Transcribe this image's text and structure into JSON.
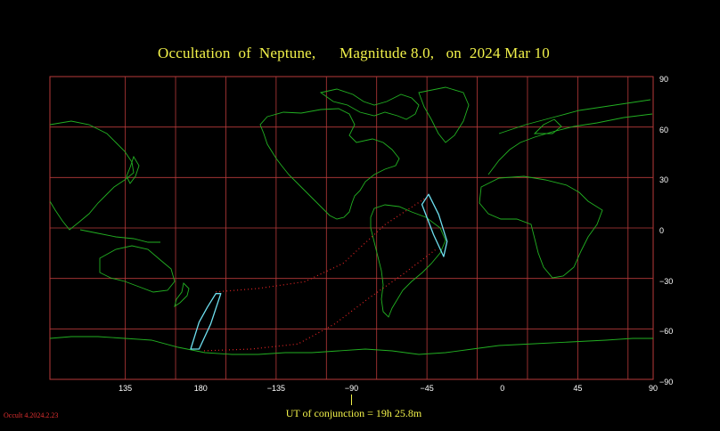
{
  "title": "Occultation  of  Neptune,      Magnitude 8.0,   on  2024 Mar 10",
  "conjunction_label": "UT of conjunction = 19h 25.8m",
  "footer": "Occult 4.2024.2.23",
  "colors": {
    "background": "#000000",
    "grid": "#b83a3a",
    "coast": "#22b022",
    "path": "#6ee0f0",
    "dots": "#e02424",
    "title": "#f2f24a"
  },
  "lon_labels": [
    "135",
    "180",
    "−135",
    "−90",
    "−45",
    "0",
    "45",
    "90"
  ],
  "lat_labels": [
    "90",
    "60",
    "30",
    "0",
    "−30",
    "−60",
    "−90"
  ],
  "map": {
    "projection": "equirectangular",
    "lon_range": [
      90,
      450
    ],
    "lat_range": [
      -90,
      90
    ],
    "graticule_step_deg": 30,
    "visibility_region_1": {
      "description": "closed occultation visibility curve",
      "points": [
        [
          -48,
          14
        ],
        [
          -44,
          20
        ],
        [
          -38,
          8
        ],
        [
          -33,
          -8
        ],
        [
          -35,
          -17
        ],
        [
          -41,
          -4
        ],
        [
          -48,
          14
        ]
      ]
    },
    "visibility_region_2": {
      "points": [
        [
          -176,
          -47
        ],
        [
          -171,
          -39
        ],
        [
          -168,
          -39
        ],
        [
          -174,
          -57
        ],
        [
          -181,
          -72
        ],
        [
          -186,
          -72
        ],
        [
          -181,
          -56
        ],
        [
          -176,
          -47
        ]
      ]
    },
    "dotted_paths": [
      {
        "points": [
          [
            -171,
            -38
          ],
          [
            -146,
            -36
          ],
          [
            -118,
            -32
          ],
          [
            -95,
            -21
          ],
          [
            -70,
            2
          ],
          [
            -44,
            19
          ]
        ]
      },
      {
        "points": [
          [
            -178,
            -73
          ],
          [
            -150,
            -72
          ],
          [
            -122,
            -69
          ],
          [
            -100,
            -57
          ],
          [
            -80,
            -42
          ],
          [
            -60,
            -28
          ],
          [
            -40,
            -13
          ]
        ]
      }
    ]
  }
}
